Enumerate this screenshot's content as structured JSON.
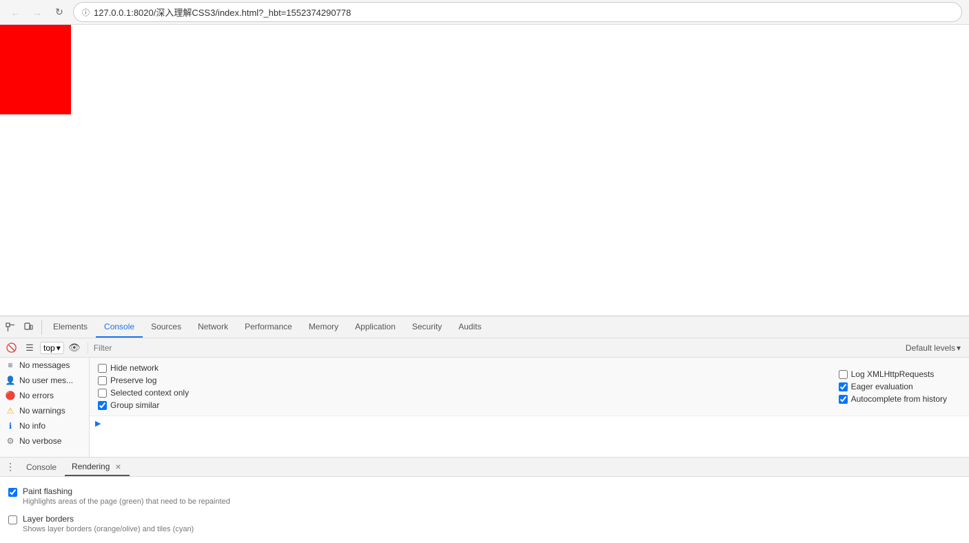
{
  "browser": {
    "url": "127.0.0.1:8020/深入理解CSS3/index.html?_hbt=1552374290778",
    "back_disabled": true,
    "forward_disabled": true
  },
  "devtools": {
    "tabs": [
      {
        "label": "Elements",
        "active": false
      },
      {
        "label": "Console",
        "active": true
      },
      {
        "label": "Sources",
        "active": false
      },
      {
        "label": "Network",
        "active": false
      },
      {
        "label": "Performance",
        "active": false
      },
      {
        "label": "Memory",
        "active": false
      },
      {
        "label": "Application",
        "active": false
      },
      {
        "label": "Security",
        "active": false
      },
      {
        "label": "Audits",
        "active": false
      }
    ],
    "console": {
      "context": "top",
      "filter_placeholder": "Filter",
      "default_levels": "Default levels",
      "sidebar_items": [
        {
          "icon": "list",
          "label": "No messages",
          "active": false
        },
        {
          "icon": "user",
          "label": "No user mes...",
          "active": false
        },
        {
          "icon": "error",
          "label": "No errors",
          "active": false
        },
        {
          "icon": "warning",
          "label": "No warnings",
          "active": false
        },
        {
          "icon": "info",
          "label": "No info",
          "active": false
        },
        {
          "icon": "verbose",
          "label": "No verbose",
          "active": false
        }
      ],
      "options_left": [
        {
          "label": "Hide network",
          "checked": false
        },
        {
          "label": "Preserve log",
          "checked": false
        },
        {
          "label": "Selected context only",
          "checked": false
        },
        {
          "label": "Group similar",
          "checked": true
        }
      ],
      "options_right": [
        {
          "label": "Log XMLHttpRequests",
          "checked": false
        },
        {
          "label": "Eager evaluation",
          "checked": true
        },
        {
          "label": "Autocomplete from history",
          "checked": true
        }
      ]
    }
  },
  "drawer": {
    "tabs": [
      {
        "label": "Console",
        "active": false,
        "closable": false
      },
      {
        "label": "Rendering",
        "active": true,
        "closable": true
      }
    ],
    "rendering_options": [
      {
        "title": "Paint flashing",
        "desc": "Highlights areas of the page (green) that need to be repainted",
        "checked": true
      },
      {
        "title": "Layer borders",
        "desc": "Shows layer borders (orange/olive) and tiles (cyan)",
        "checked": false
      }
    ]
  }
}
